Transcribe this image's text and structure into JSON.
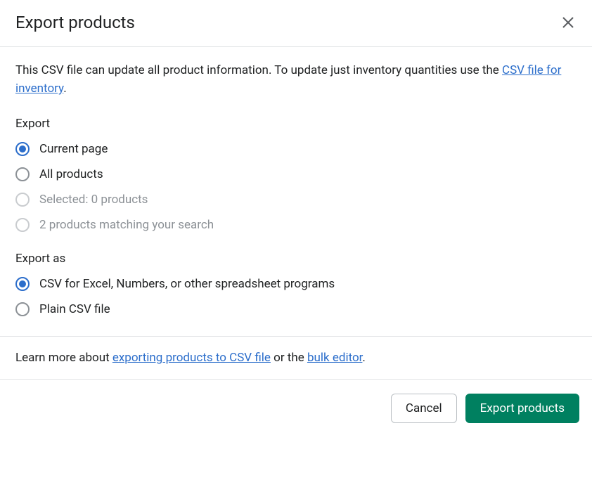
{
  "header": {
    "title": "Export products"
  },
  "description": {
    "text_before": "This CSV file can update all product information. To update just inventory quantities use the ",
    "link_text": "CSV file for inventory",
    "text_after": "."
  },
  "export_scope": {
    "label": "Export",
    "options": {
      "current_page": "Current page",
      "all_products": "All products",
      "selected": "Selected: 0 products",
      "matching": "2 products matching your search"
    }
  },
  "export_format": {
    "label": "Export as",
    "options": {
      "csv_excel": "CSV for Excel, Numbers, or other spreadsheet programs",
      "plain_csv": "Plain CSV file"
    }
  },
  "learn": {
    "text_before": "Learn more about ",
    "link1": "exporting products to CSV file",
    "text_mid": " or the ",
    "link2": "bulk editor",
    "text_after": "."
  },
  "footer": {
    "cancel": "Cancel",
    "submit": "Export products"
  }
}
